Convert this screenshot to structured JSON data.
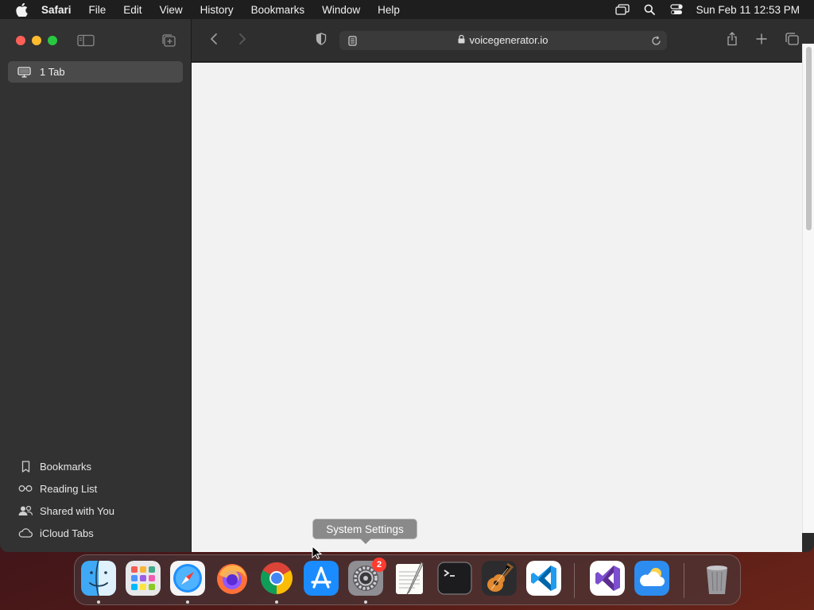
{
  "menubar": {
    "app_name": "Safari",
    "items": [
      "File",
      "Edit",
      "View",
      "History",
      "Bookmarks",
      "Window",
      "Help"
    ],
    "clock": "Sun Feb 11  12:53 PM",
    "status_icons": [
      "screen-mirroring-icon",
      "spotlight-search-icon",
      "control-center-icon"
    ]
  },
  "sidebar": {
    "tab_group_label": "1 Tab",
    "links": [
      {
        "label": "Bookmarks",
        "icon": "bookmark-icon"
      },
      {
        "label": "Reading List",
        "icon": "reading-list-icon"
      },
      {
        "label": "Shared with You",
        "icon": "shared-with-you-icon"
      },
      {
        "label": "iCloud Tabs",
        "icon": "icloud-icon"
      }
    ]
  },
  "toolbar": {
    "url": "voicegenerator.io"
  },
  "tooltip": {
    "text": "System Settings"
  },
  "dock": {
    "apps": [
      "Finder",
      "Launchpad",
      "Safari",
      "Firefox",
      "Google Chrome",
      "App Store",
      "System Settings",
      "TextEdit",
      "Terminal",
      "GarageBand",
      "Visual Studio Code",
      "Visual Studio",
      "Weather",
      "Trash"
    ],
    "system_settings_badge": "2"
  },
  "colors": {
    "close": "#fe5f57",
    "minimize": "#febc2e",
    "maximize": "#28c840",
    "badge": "#ff3b30"
  }
}
